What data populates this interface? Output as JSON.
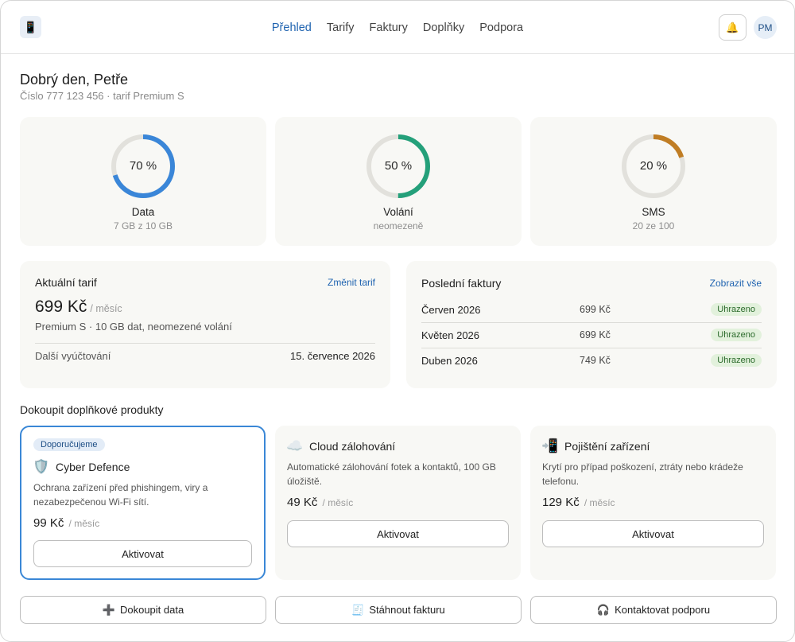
{
  "header": {
    "logo_icon": "phone-icon",
    "nav": [
      {
        "label": "Přehled",
        "active": true
      },
      {
        "label": "Tarify"
      },
      {
        "label": "Faktury"
      },
      {
        "label": "Doplňky"
      },
      {
        "label": "Podpora"
      }
    ],
    "notification_icon": "bell-icon",
    "avatar_initials": "PM"
  },
  "greeting": {
    "title": "Dobrý den, Petře",
    "subtitle": "Číslo 777 123 456 · tarif Premium S"
  },
  "usage": [
    {
      "percent_label": "70 %",
      "percent": 70,
      "label": "Data",
      "sub": "7 GB z 10 GB",
      "color": "#3a86d8"
    },
    {
      "percent_label": "50 %",
      "percent": 50,
      "label": "Volání",
      "sub": "neomezeně",
      "color": "#24a07a"
    },
    {
      "percent_label": "20 %",
      "percent": 20,
      "label": "SMS",
      "sub": "20 ze 100",
      "color": "#c07d24"
    }
  ],
  "tariff": {
    "title": "Aktuální tarif",
    "change_link": "Změnit tarif",
    "price": "699 Kč",
    "per": "/ měsíc",
    "description": "Premium S · 10 GB dat, neomezené volání",
    "billing_label": "Další vyúčtování",
    "billing_date": "15. července 2026"
  },
  "invoices": {
    "title": "Poslední faktury",
    "show_all": "Zobrazit vše",
    "rows": [
      {
        "month": "Červen 2026",
        "amount": "699 Kč",
        "status": "Uhrazeno"
      },
      {
        "month": "Květen 2026",
        "amount": "699 Kč",
        "status": "Uhrazeno"
      },
      {
        "month": "Duben 2026",
        "amount": "749 Kč",
        "status": "Uhrazeno"
      }
    ]
  },
  "addons": {
    "title": "Dokoupit doplňkové produkty",
    "items": [
      {
        "badge": "Doporučujeme",
        "icon": "shield-icon",
        "name": "Cyber Defence",
        "description": "Ochrana zařízení před phishingem, viry a nezabezpečenou Wi-Fi sítí.",
        "price": "99 Kč",
        "per": "/ měsíc",
        "button": "Aktivovat"
      },
      {
        "icon": "cloud-icon",
        "name": "Cloud zálohování",
        "description": "Automatické zálohování fotek a kontaktů, 100 GB úložiště.",
        "price": "49 Kč",
        "per": "/ měsíc",
        "button": "Aktivovat"
      },
      {
        "icon": "phone-arrow-icon",
        "name": "Pojištění zařízení",
        "description": "Krytí pro případ poškození, ztráty nebo krádeže telefonu.",
        "price": "129 Kč",
        "per": "/ měsíc",
        "button": "Aktivovat"
      }
    ]
  },
  "actions": [
    {
      "icon": "plus-icon",
      "label": "Dokoupit data"
    },
    {
      "icon": "receipt-icon",
      "label": "Stáhnout fakturu"
    },
    {
      "icon": "headphones-icon",
      "label": "Kontaktovat podporu"
    }
  ]
}
